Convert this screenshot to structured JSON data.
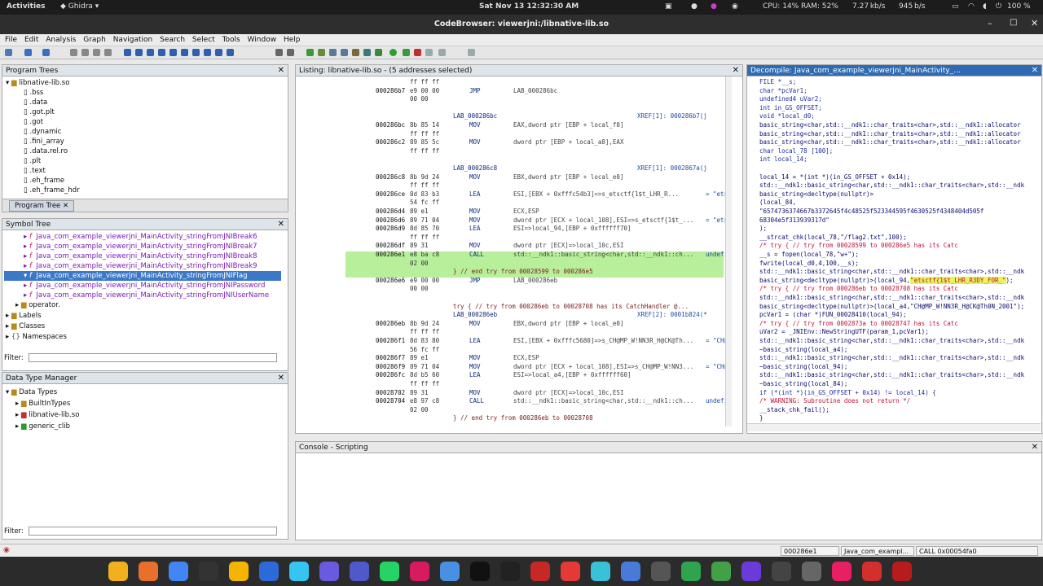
{
  "gnome": {
    "activities": "Activities",
    "app": "Ghidra",
    "clock": "Sat Nov 13  12:32:30 AM",
    "cpu": "CPU: 14% RAM: 52%",
    "net_down": "7.27 kb/s",
    "net_up": "945 b/s",
    "battery": "100 %"
  },
  "window": {
    "title": "CodeBrowser: viewerjni:/libnative-lib.so"
  },
  "menu": [
    "File",
    "Edit",
    "Analysis",
    "Graph",
    "Navigation",
    "Search",
    "Select",
    "Tools",
    "Window",
    "Help"
  ],
  "program_trees": {
    "title": "Program Trees",
    "root": "libnative-lib.so",
    "items": [
      ".bss",
      ".data",
      ".got.plt",
      ".got",
      ".dynamic",
      ".fini_array",
      ".data.rel.ro",
      ".plt",
      ".text",
      ".eh_frame",
      ".eh_frame_hdr"
    ],
    "tab": "Program Tree"
  },
  "symbol_tree": {
    "title": "Symbol Tree",
    "items": [
      "Java_com_example_viewerjni_MainActivity_stringFromJNIBreak6",
      "Java_com_example_viewerjni_MainActivity_stringFromJNIBreak7",
      "Java_com_example_viewerjni_MainActivity_stringFromJNIBreak8",
      "Java_com_example_viewerjni_MainActivity_stringFromJNIBreak9",
      "Java_com_example_viewerjni_MainActivity_stringFromJNIFlag",
      "Java_com_example_viewerjni_MainActivity_stringFromJNIPassword",
      "Java_com_example_viewerjni_MainActivity_stringFromJNIUserName"
    ],
    "groups": [
      "operator.",
      "Labels",
      "Classes",
      "Namespaces"
    ],
    "filter_label": "Filter:"
  },
  "data_types": {
    "title": "Data Type Manager",
    "root": "Data Types",
    "items": [
      "BuiltInTypes",
      "libnative-lib.so",
      "generic_clib"
    ],
    "filter_label": "Filter:"
  },
  "listing": {
    "title": "Listing:  libnative-lib.so - (5 addresses selected)"
  },
  "listing_rows": [
    [
      "",
      "ff ff ff",
      "",
      "",
      ""
    ],
    [
      "000286b7",
      "e9 00 00",
      "JMP",
      "LAB_000286bc",
      ""
    ],
    [
      "",
      "00 00",
      "",
      "",
      ""
    ],
    [
      "",
      "",
      "",
      "",
      ""
    ],
    [
      "",
      "",
      "LAB_000286bc",
      "",
      "XREF[1]:     000286b7(j"
    ],
    [
      "000286bc",
      "8b 85 14",
      "MOV",
      "EAX,dword ptr [EBP + local_f0]",
      ""
    ],
    [
      "",
      "ff ff ff",
      "",
      "",
      ""
    ],
    [
      "000286c2",
      "89 85 5c",
      "MOV",
      "dword ptr [EBP + local_a8],EAX",
      ""
    ],
    [
      "",
      "ff ff ff",
      "",
      "",
      ""
    ],
    [
      "",
      "",
      "",
      "",
      ""
    ],
    [
      "",
      "",
      "LAB_000286c8",
      "",
      "XREF[1]:     0002867a(j"
    ],
    [
      "000286c8",
      "8b 9d 24",
      "MOV",
      "EBX,dword ptr [EBP + local_e0]",
      ""
    ],
    [
      "",
      "ff ff ff",
      "",
      "",
      ""
    ],
    [
      "000286ce",
      "8d 83 b3",
      "LEA",
      "ESI,[EBX + 0xfffc54b3]=>s_etsctf{1$t_LHR_R...",
      "= \"etsc"
    ],
    [
      "",
      "54 fc ff",
      "",
      "",
      ""
    ],
    [
      "000286d4",
      "89 e1",
      "MOV",
      "ECX,ESP",
      ""
    ],
    [
      "000286d6",
      "89 71 04",
      "MOV",
      "dword ptr [ECX + local_108],ESI=>s_etsctf{1$t_...",
      "= \"etsc"
    ],
    [
      "000286d9",
      "8d 85 70",
      "LEA",
      "ESI=>local_94,[EBP + 0xffffff70]",
      ""
    ],
    [
      "",
      "ff ff ff",
      "",
      "",
      ""
    ],
    [
      "000286df",
      "89 31",
      "MOV",
      "dword ptr [ECX]=>local_10c,ESI",
      ""
    ],
    [
      "000286e1",
      "e8 ba c8",
      "CALL",
      "std::__ndk1::basic_string<char,std::__ndk1::ch...",
      "undefin"
    ],
    [
      "",
      "02 00",
      "",
      "",
      ""
    ],
    [
      "",
      "",
      "} // end try from 00028599 to 000286e5",
      "",
      ""
    ],
    [
      "000286e6",
      "e9 00 00",
      "JMP",
      "LAB_000286eb",
      ""
    ],
    [
      "",
      "00 00",
      "",
      "",
      ""
    ],
    [
      "",
      "",
      "",
      "",
      ""
    ],
    [
      "",
      "",
      "try { // try from 000286eb to 00028708 has its CatchHandler @...",
      "",
      ""
    ],
    [
      "",
      "",
      "LAB_000286eb",
      "",
      "XREF[2]:     0001b824(*"
    ],
    [
      "000286eb",
      "8b 9d 24",
      "MOV",
      "EBX,dword ptr [EBP + local_e0]",
      ""
    ],
    [
      "",
      "ff ff ff",
      "",
      "",
      ""
    ],
    [
      "000286f1",
      "8d 83 80",
      "LEA",
      "ESI,[EBX + 0xfffc5680]=>s_CH@MP_W!NN3R_H@CK@Th...",
      "= \"CH@M"
    ],
    [
      "",
      "56 fc ff",
      "",
      "",
      ""
    ],
    [
      "000286f7",
      "89 e1",
      "MOV",
      "ECX,ESP",
      ""
    ],
    [
      "000286f9",
      "89 71 04",
      "MOV",
      "dword ptr [ECX + local_108],ESI=>s_CH@MP_W!NN3...",
      "= \"CH@M"
    ],
    [
      "000286fc",
      "8d b5 60",
      "LEA",
      "ESI=>local_a4,[EBP + 0xffffff60]",
      ""
    ],
    [
      "",
      "ff ff ff",
      "",
      "",
      ""
    ],
    [
      "00028702",
      "89 31",
      "MOV",
      "dword ptr [ECX]=>local_10c,ESI",
      ""
    ],
    [
      "00028704",
      "e8 97 c8",
      "CALL",
      "std::__ndk1::basic_string<char,std::__ndk1::ch...",
      "undefin"
    ],
    [
      "",
      "02 00",
      "",
      "",
      ""
    ],
    [
      "",
      "",
      "} // end try from 000286eb to 00028708",
      "",
      ""
    ]
  ],
  "decompile": {
    "title": "Decompile: Java_com_example_viewerjni_MainActivity_..."
  },
  "decomp_lines": [
    "FILE *__s;",
    "char *pcVar1;",
    "undefined4 uVar2;",
    "int in_GS_OFFSET;",
    "void *local_d0;",
    "basic_string<char,std::__ndk1::char_traits<char>,std::__ndk1::allocator",
    "basic_string<char,std::__ndk1::char_traits<char>,std::__ndk1::allocator",
    "basic_string<char,std::__ndk1::char_traits<char>,std::__ndk1::allocator",
    "char local_78 [100];",
    "int local_14;",
    "",
    "local_14 = *(int *)(in_GS_OFFSET + 0x14);",
    "std::__ndk1::basic_string<char,std::__ndk1::char_traits<char>,std::__ndk",
    "basic_string<decltype(nullptr)>",
    "          (local_84,",
    "           \"6574736374667b3372645f4c48525f523344595f4630525f4348404d505f",
    "           68304e5f313939317d\"",
    "          );",
    "__strcat_chk(local_78,\"/flag2.txt\",100);",
    "                  /* try { // try from 00028599 to 000286e5 has its Catc",
    "__s = fopen(local_78,\"w+\");",
    "fwrite(local_d0,4,100,__s);",
    "std::__ndk1::basic_string<char,std::__ndk1::char_traits<char>,std::__ndk",
    "basic_string<decltype(nullptr)>(local_94,",
    "                  /* try { // try from 000286eb to 00028708 has its Catc",
    "std::__ndk1::basic_string<char,std::__ndk1::char_traits<char>,std::__ndk",
    "basic_string<decltype(nullptr)>(local_a4,\"CH@MP_W!NN3R_H@CK@Th0N_2001\");",
    "pcVar1 = (char *)FUN_00028410(local_94);",
    "                  /* try { // try from 0002873a to 00028747 has its Catc",
    "uVar2 = _JNIEnv::NewStringUTF(param_1,pcVar1);",
    "std::__ndk1::basic_string<char,std::__ndk1::char_traits<char>,std::__ndk",
    "~basic_string(local_a4);",
    "std::__ndk1::basic_string<char,std::__ndk1::char_traits<char>,std::__ndk",
    "~basic_string(local_94);",
    "std::__ndk1::basic_string<char,std::__ndk1::char_traits<char>,std::__ndk",
    "~basic_string(local_84);",
    "if (*(int *)(in_GS_OFFSET + 0x14) != local_14) {",
    "                  /* WARNING: Subroutine does not return */",
    "  __stack_chk_fail();",
    "}"
  ],
  "decomp_highlight": "\"etsctf{1$t_LHR_R3DY_FOR_\"",
  "decomp_highlight_tail": ");",
  "console": {
    "title": "Console - Scripting"
  },
  "status": {
    "addr": "000286e1",
    "func": "Java_com_exampl...",
    "call": "CALL 0x00054fa0"
  },
  "colors": {
    "selection": "#3c78c8",
    "listing_highlight": "#b7ef9b",
    "decomp_highlight": "#e8f55a"
  }
}
